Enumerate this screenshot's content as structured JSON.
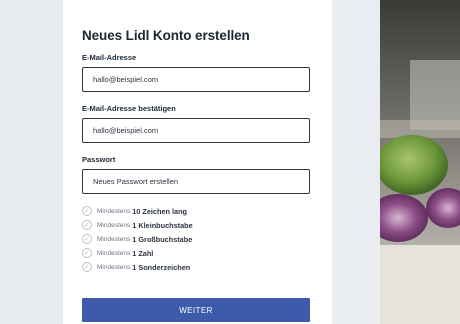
{
  "form": {
    "title": "Neues Lidl Konto erstellen",
    "email": {
      "label": "E-Mail-Adresse",
      "value": "hallo@beispiel.com"
    },
    "email_confirm": {
      "label": "E-Mail-Adresse bestätigen",
      "value": "hallo@beispiel.com"
    },
    "password": {
      "label": "Passwort",
      "placeholder": "Neues Passwort erstellen"
    },
    "requirements": [
      {
        "prefix": "Mindestens",
        "text": "10 Zeichen lang"
      },
      {
        "prefix": "Mindestens",
        "text": "1 Kleinbuchstabe"
      },
      {
        "prefix": "Mindestens",
        "text": "1 Großbuchstabe"
      },
      {
        "prefix": "Mindestens",
        "text": "1 Zahl"
      },
      {
        "prefix": "Mindestens",
        "text": "1 Sonderzeichen"
      }
    ],
    "submit_label": "WEITER"
  },
  "colors": {
    "button": "#3e5ba9",
    "background": "#e9ecf0",
    "panel": "#ffffff"
  },
  "icons": {
    "requirement": "check-circle-icon"
  }
}
